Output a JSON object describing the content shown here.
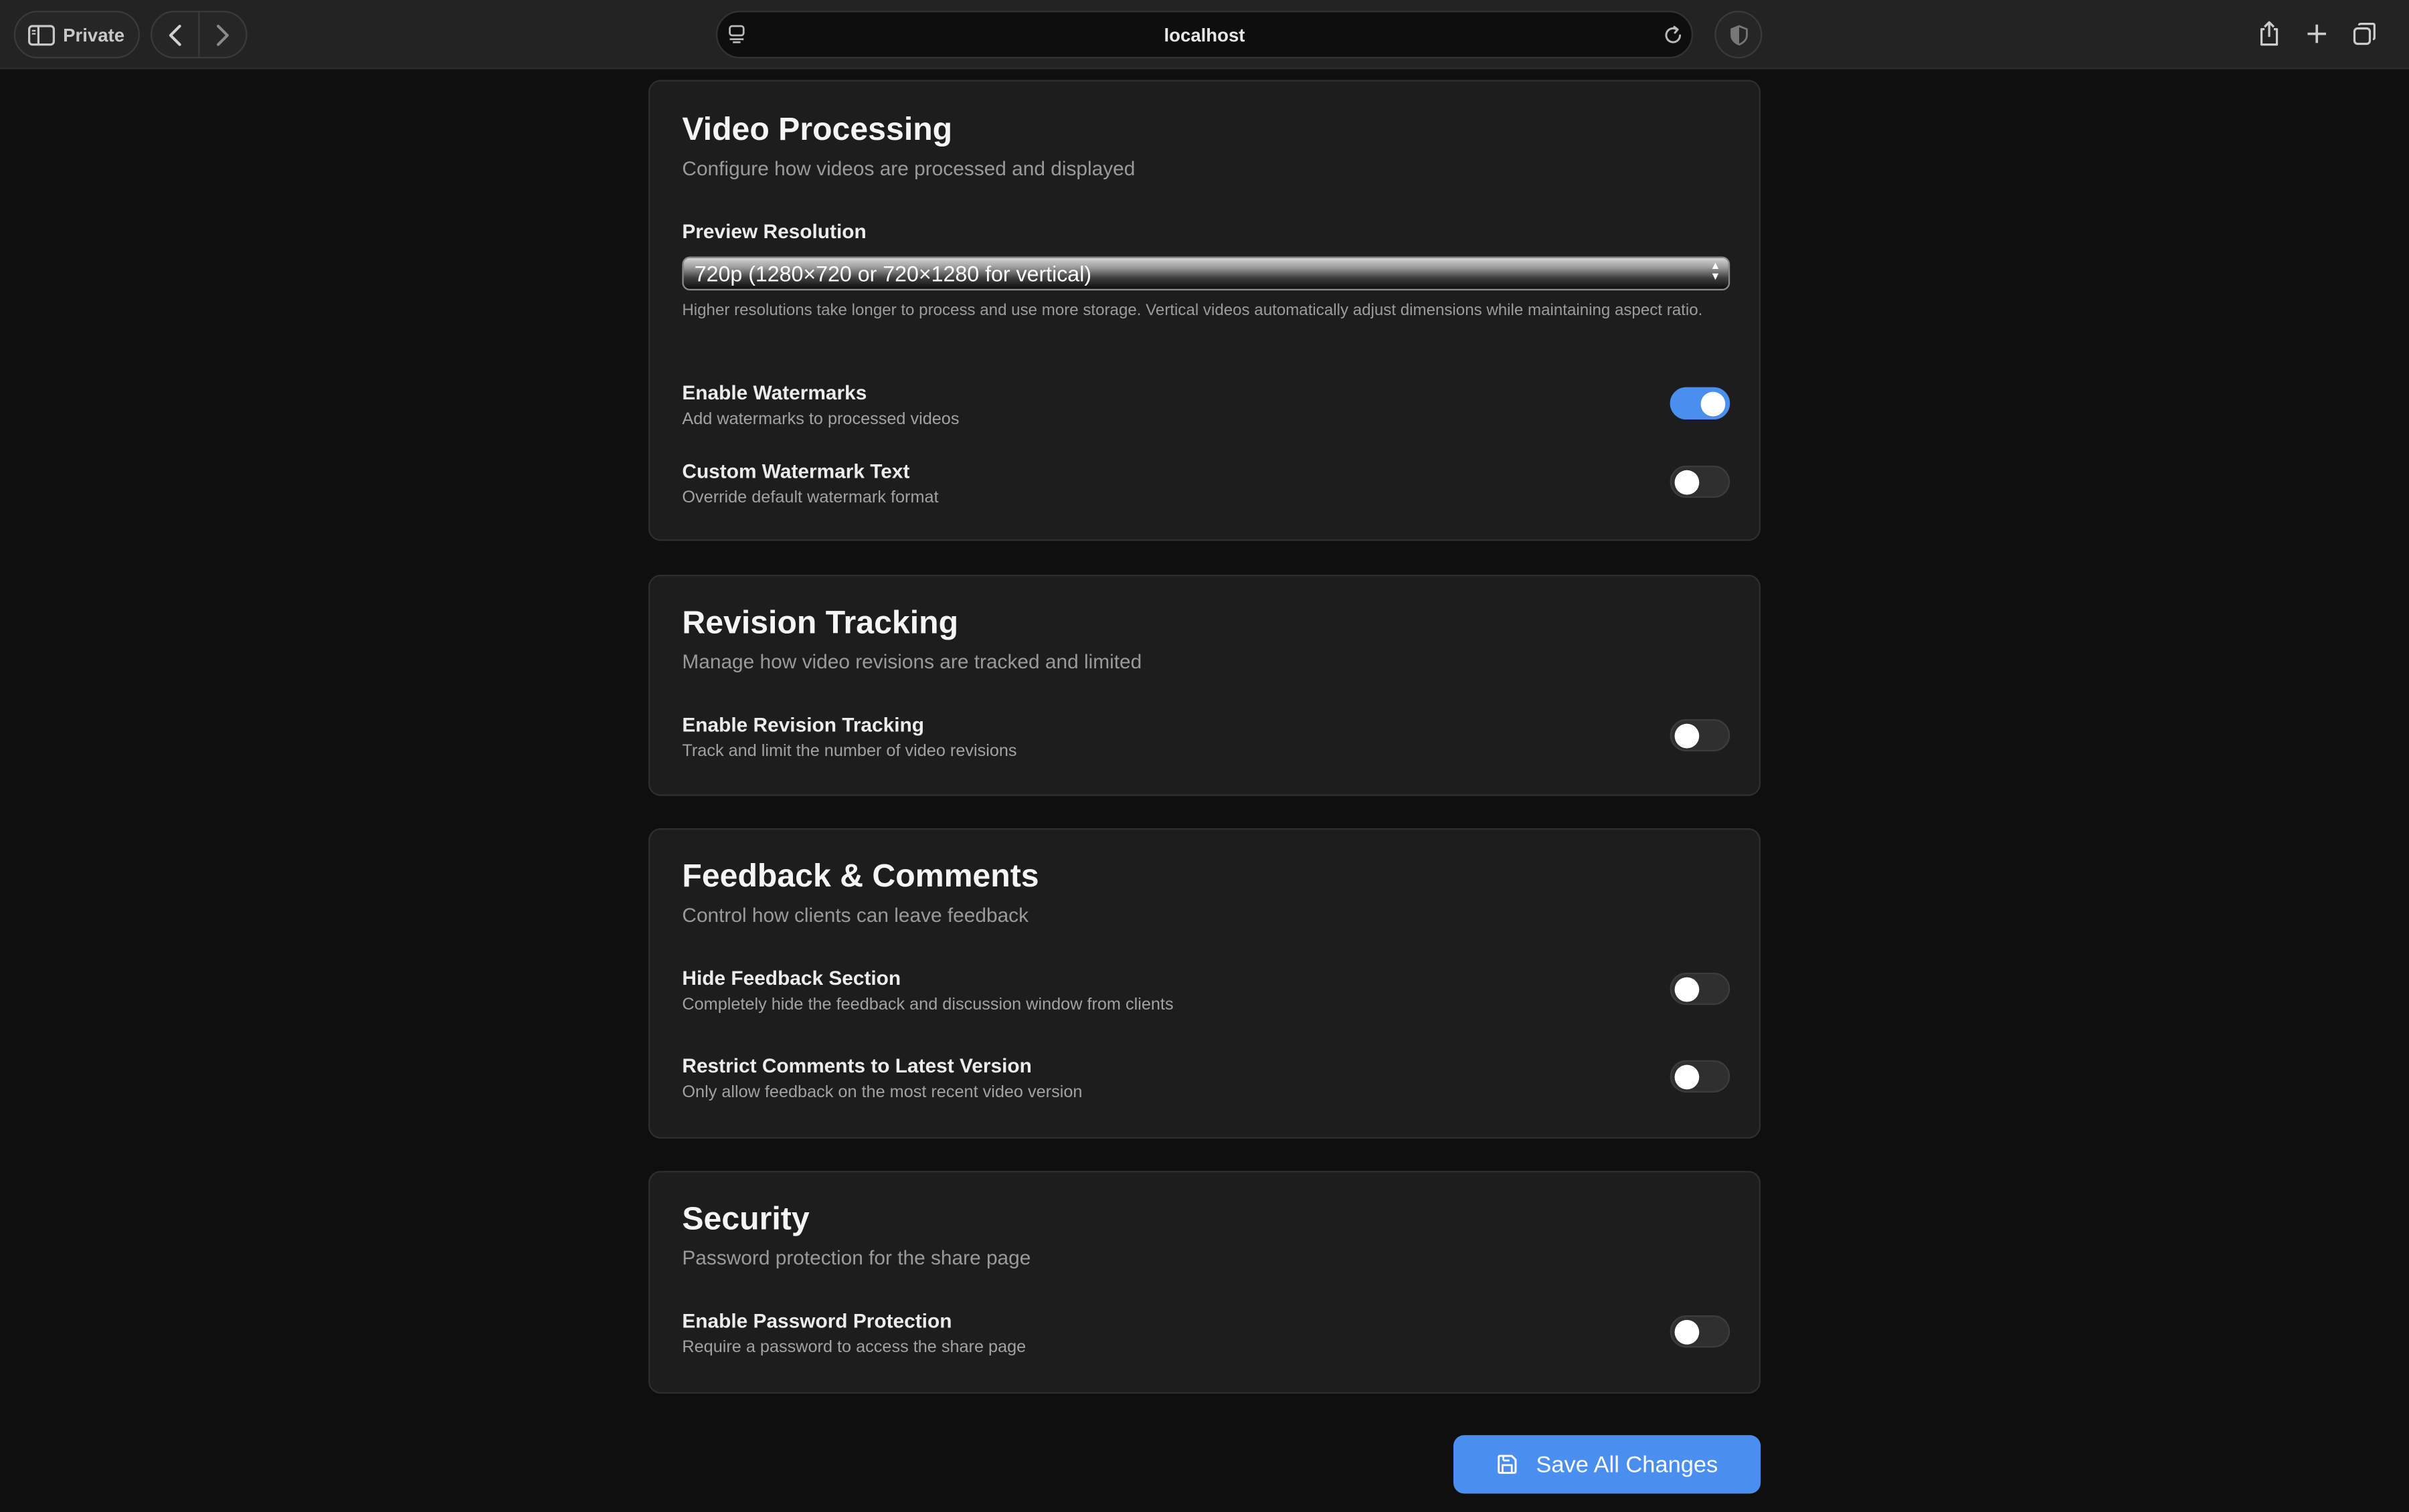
{
  "browser": {
    "private_label": "Private",
    "url": "localhost"
  },
  "sections": {
    "video": {
      "title": "Video Processing",
      "subtitle": "Configure how videos are processed and displayed",
      "resolution_label": "Preview Resolution",
      "resolution_value": "720p (1280×720 or 720×1280 for vertical)",
      "resolution_help": "Higher resolutions take longer to process and use more storage. Vertical videos automatically adjust dimensions while maintaining aspect ratio.",
      "watermarks_label": "Enable Watermarks",
      "watermarks_desc": "Add watermarks to processed videos",
      "watermarks_on": true,
      "custom_label": "Custom Watermark Text",
      "custom_desc": "Override default watermark format",
      "custom_on": false
    },
    "revision": {
      "title": "Revision Tracking",
      "subtitle": "Manage how video revisions are tracked and limited",
      "enable_label": "Enable Revision Tracking",
      "enable_desc": "Track and limit the number of video revisions",
      "enable_on": false
    },
    "feedback": {
      "title": "Feedback & Comments",
      "subtitle": "Control how clients can leave feedback",
      "hide_label": "Hide Feedback Section",
      "hide_desc": "Completely hide the feedback and discussion window from clients",
      "hide_on": false,
      "restrict_label": "Restrict Comments to Latest Version",
      "restrict_desc": "Only allow feedback on the most recent video version",
      "restrict_on": false
    },
    "security": {
      "title": "Security",
      "subtitle": "Password protection for the share page",
      "password_label": "Enable Password Protection",
      "password_desc": "Require a password to access the share page",
      "password_on": false
    }
  },
  "save_button": {
    "label": "Save All Changes"
  },
  "colors": {
    "accent": "#4a8ff0",
    "card_bg": "#1d1d1d",
    "page_bg": "#0f0f0f"
  }
}
